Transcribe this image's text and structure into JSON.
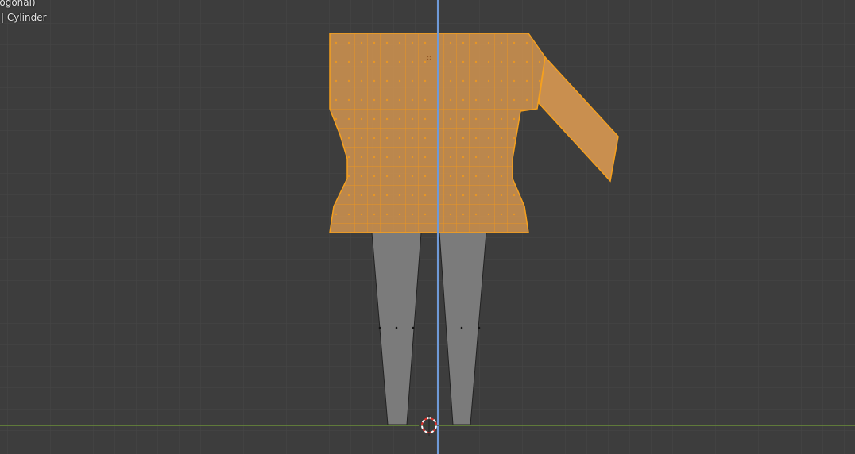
{
  "overlay": {
    "view_name": "(Orthogonal)",
    "view_name_visible": "ogonal)",
    "object_info": "| Cylinder"
  },
  "colors": {
    "background": "#3d3d3d",
    "grid": "#474747",
    "selection": "#f5a01e",
    "z_axis": "#6f9ad8",
    "horizon": "#6b8e3a",
    "unselected_mesh": "#7a7a7a"
  }
}
